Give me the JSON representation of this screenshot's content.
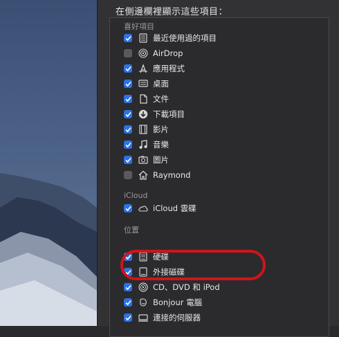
{
  "prefs": {
    "heading": "在側邊欄裡顯示這些項目：",
    "sections": {
      "favorites": "喜好項目",
      "icloud": "iCloud",
      "locations": "位置"
    },
    "favorites": [
      {
        "label": "最近使用過的項目",
        "checked": true,
        "icon": "recents-icon"
      },
      {
        "label": "AirDrop",
        "checked": false,
        "icon": "airdrop-icon"
      },
      {
        "label": "應用程式",
        "checked": true,
        "icon": "applications-icon"
      },
      {
        "label": "桌面",
        "checked": true,
        "icon": "desktop-icon"
      },
      {
        "label": "文件",
        "checked": true,
        "icon": "documents-icon"
      },
      {
        "label": "下載項目",
        "checked": true,
        "icon": "downloads-icon"
      },
      {
        "label": "影片",
        "checked": true,
        "icon": "movies-icon"
      },
      {
        "label": "音樂",
        "checked": true,
        "icon": "music-icon"
      },
      {
        "label": "圖片",
        "checked": true,
        "icon": "pictures-icon"
      },
      {
        "label": "Raymond",
        "checked": false,
        "icon": "home-icon"
      }
    ],
    "icloud": [
      {
        "label": "iCloud 雲碟",
        "checked": true,
        "icon": "cloud-icon"
      }
    ],
    "locations": [
      {
        "label": "硬碟",
        "checked": true,
        "icon": "hard-disk-icon"
      },
      {
        "label": "外接磁碟",
        "checked": true,
        "icon": "external-disk-icon"
      },
      {
        "label": "CD、DVD 和 iPod",
        "checked": true,
        "icon": "cd-dvd-icon"
      },
      {
        "label": "Bonjour 電腦",
        "checked": true,
        "icon": "bonjour-icon"
      },
      {
        "label": "連接的伺服器",
        "checked": true,
        "icon": "server-icon"
      }
    ]
  },
  "colors": {
    "accent": "#2c72e8",
    "highlight": "#d0141c"
  }
}
